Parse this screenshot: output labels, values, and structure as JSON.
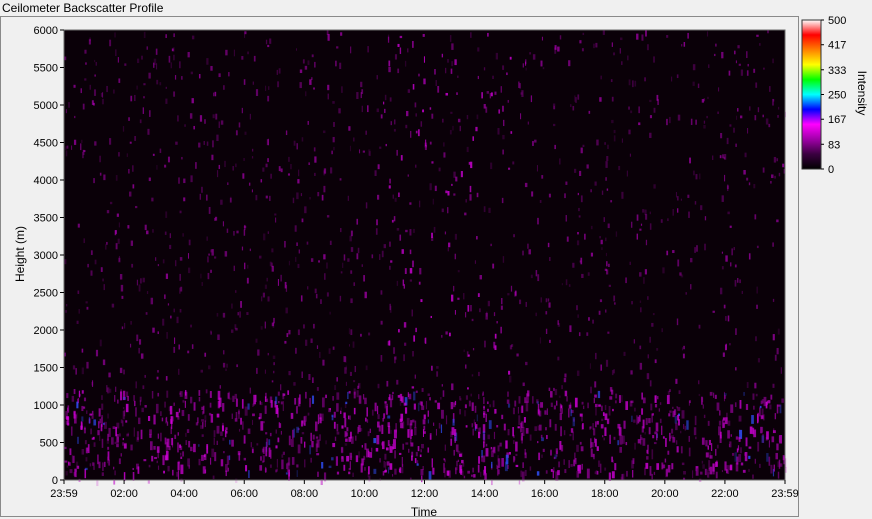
{
  "window": {
    "title": "Ceilometer Backscatter Profile"
  },
  "chart_data": {
    "type": "heatmap",
    "title": "Ceilometer Backscatter Profile",
    "xlabel": "Time",
    "ylabel": "Height (m)",
    "x_ticks": [
      "23:59",
      "02:00",
      "04:00",
      "06:00",
      "08:00",
      "10:00",
      "12:00",
      "14:00",
      "16:00",
      "18:00",
      "20:00",
      "22:00",
      "23:59"
    ],
    "y_ticks": [
      0,
      500,
      1000,
      1500,
      2000,
      2500,
      3000,
      3500,
      4000,
      4500,
      5000,
      5500,
      6000
    ],
    "ylim": [
      0,
      6000
    ],
    "colorbar": {
      "label": "Intensity",
      "ticks": [
        500,
        417,
        333,
        250,
        167,
        83,
        0
      ],
      "range": [
        0,
        500
      ],
      "colors": [
        "#000000",
        "#3a0040",
        "#a000a8",
        "#ff00ff",
        "#0000ff",
        "#00ffff",
        "#00ff00",
        "#ffff00",
        "#ff8000",
        "#ff0000",
        "#ffffff"
      ]
    },
    "grid": false
  }
}
